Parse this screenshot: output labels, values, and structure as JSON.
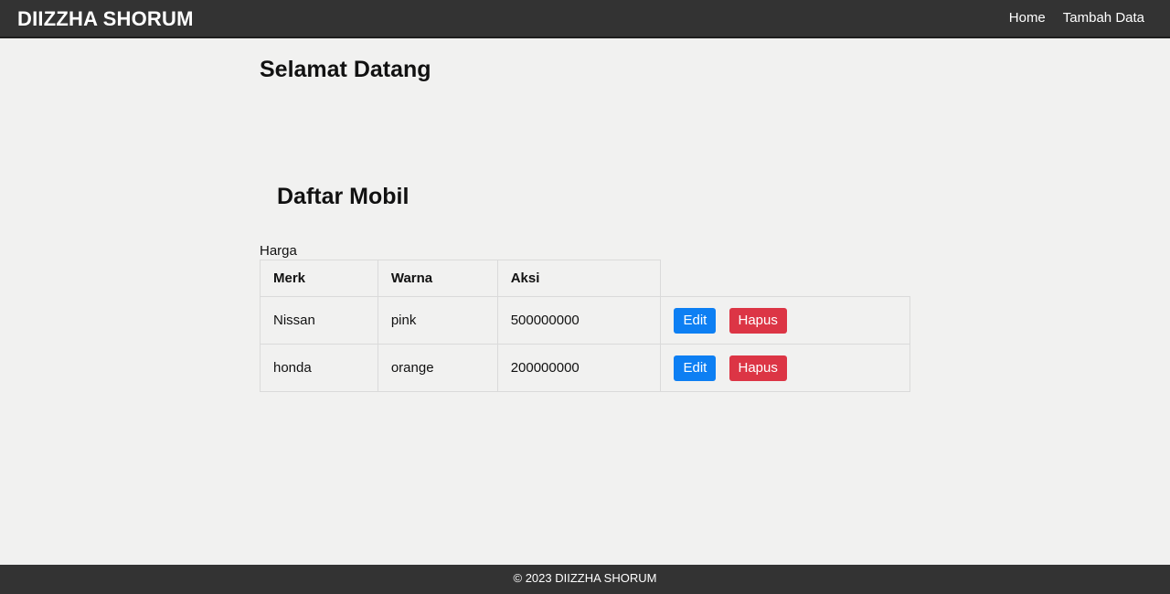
{
  "header": {
    "brand": "DIIZZHA SHORUM",
    "nav": [
      {
        "label": "Home"
      },
      {
        "label": "Tambah Data"
      }
    ]
  },
  "main": {
    "welcome": "Selamat Datang",
    "list_title": "Daftar Mobil",
    "harga_label": "Harga",
    "table": {
      "columns": [
        "Merk",
        "Warna",
        "Aksi"
      ],
      "rows": [
        {
          "merk": "Nissan",
          "warna": "pink",
          "harga": "500000000",
          "edit_label": "Edit",
          "delete_label": "Hapus"
        },
        {
          "merk": "honda",
          "warna": "orange",
          "harga": "200000000",
          "edit_label": "Edit",
          "delete_label": "Hapus"
        }
      ]
    }
  },
  "footer": {
    "text": "© 2023 DIIZZHA SHORUM"
  },
  "colors": {
    "navbar": "#333333",
    "edit_button": "#0d7ff3",
    "delete_button": "#dc3545"
  }
}
